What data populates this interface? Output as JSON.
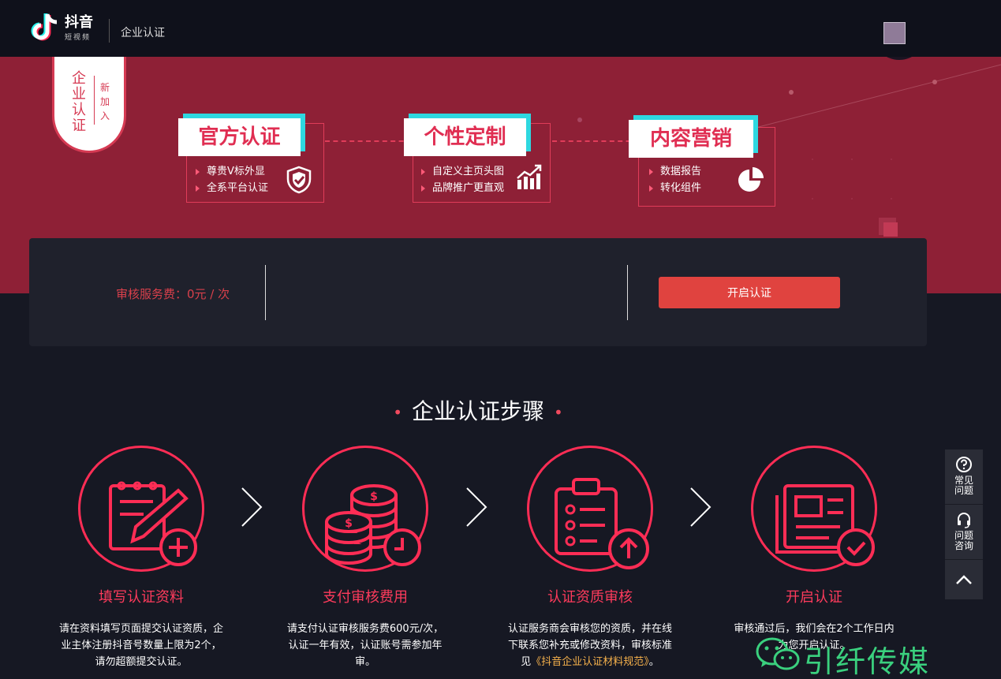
{
  "header": {
    "logo_text": "抖音",
    "logo_sub": "短视频",
    "page_title": "企业认证"
  },
  "banner": {
    "ribbon_main": "企业认证",
    "ribbon_sub": "新加入",
    "features": [
      {
        "title": "官方认证",
        "items": [
          "尊贵V标外显",
          "全系平台认证"
        ],
        "icon": "shield-check-icon"
      },
      {
        "title": "个性定制",
        "items": [
          "自定义主页头图",
          "品牌推广更直观"
        ],
        "icon": "chart-growth-icon"
      },
      {
        "title": "内容营销",
        "items": [
          "数据报告",
          "转化组件"
        ],
        "icon": "pie-chart-icon"
      }
    ]
  },
  "fee": {
    "label": "审核服务费：0元 / 次",
    "button": "开启认证"
  },
  "steps": {
    "title": "企业认证步骤",
    "items": [
      {
        "title": "填写认证资料",
        "desc": [
          "请在资料填写页面提交认证资质，企",
          "业主体注册抖音号数量上限为2个，",
          "请勿超额提交认证。"
        ],
        "icon": "form-edit-icon"
      },
      {
        "title": "支付审核费用",
        "desc": [
          "请支付认证审核服务费600元/次，",
          "认证一年有效，认证账号需参加年",
          "审。"
        ],
        "icon": "coins-clock-icon"
      },
      {
        "title": "认证资质审核",
        "desc": [
          "认证服务商会审核您的资质，并在线",
          "下联系您补充或修改资料，审核标准",
          "见",
          "《抖音企业认证材料规范》",
          "。"
        ],
        "icon": "clipboard-upload-icon"
      },
      {
        "title": "开启认证",
        "desc": [
          "审核通过后，我们会在2个工作日内",
          "为您开启认证。"
        ],
        "icon": "document-check-icon"
      }
    ]
  },
  "float_panel": {
    "faq": "常见问题",
    "consult": "问题咨询"
  },
  "watermark": {
    "text": "引纤传媒"
  },
  "colors": {
    "accent": "#ff2d55",
    "banner": "#8e2036",
    "background": "#161823",
    "button": "#e0433f",
    "cyan": "#2ed8e0"
  }
}
